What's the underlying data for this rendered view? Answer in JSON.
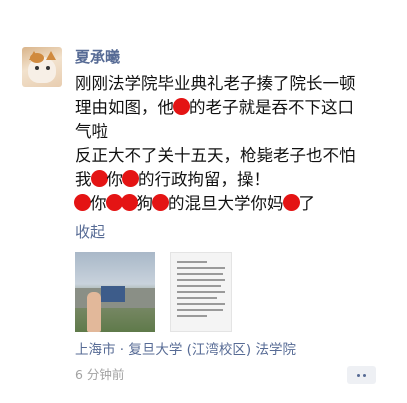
{
  "post": {
    "author": "夏承曦",
    "lines": [
      [
        "刚刚法学院毕业典礼老子揍了院长一顿"
      ],
      [
        "理由如图，他",
        "●",
        "的老子就是吞不下这口"
      ],
      [
        "气啦"
      ],
      [
        "反正大不了关十五天，枪毙老子也不怕"
      ],
      [
        "我",
        "●",
        "你",
        "●",
        "的行政拘留，操！"
      ],
      [
        "●",
        "你",
        "●",
        "●",
        "狗",
        "●",
        "的混旦大学你妈",
        "●",
        "了"
      ]
    ],
    "collapse_label": "收起",
    "location": "上海市 · 复旦大学 (江湾校区) 法学院",
    "time": "6 分钟前"
  },
  "images": [
    {
      "icon": "campus-photo"
    },
    {
      "icon": "document-photo"
    }
  ],
  "colors": {
    "link": "#576b95",
    "text": "#111111",
    "meta": "#a3a3a3",
    "redaction": "#e41414"
  }
}
